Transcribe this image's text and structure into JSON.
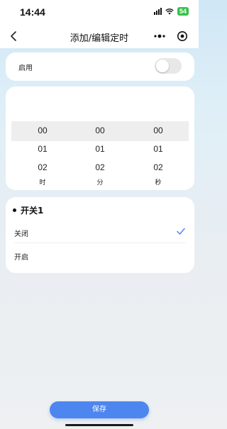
{
  "status_bar": {
    "time": "14:44",
    "battery": "54"
  },
  "nav": {
    "title": "添加/编辑定时"
  },
  "enable": {
    "label": "启用",
    "on": false
  },
  "picker": {
    "columns": [
      {
        "values": [
          "00",
          "01",
          "02"
        ],
        "unit": "时"
      },
      {
        "values": [
          "00",
          "01",
          "02"
        ],
        "unit": "分"
      },
      {
        "values": [
          "00",
          "01",
          "02"
        ],
        "unit": "秒"
      }
    ]
  },
  "switch_section": {
    "title": "开关1",
    "options": [
      {
        "label": "关闭",
        "selected": true
      },
      {
        "label": "开启",
        "selected": false
      }
    ]
  },
  "save": {
    "label": "保存"
  },
  "colors": {
    "accent": "#4e86f0",
    "check": "#4e86f0"
  }
}
